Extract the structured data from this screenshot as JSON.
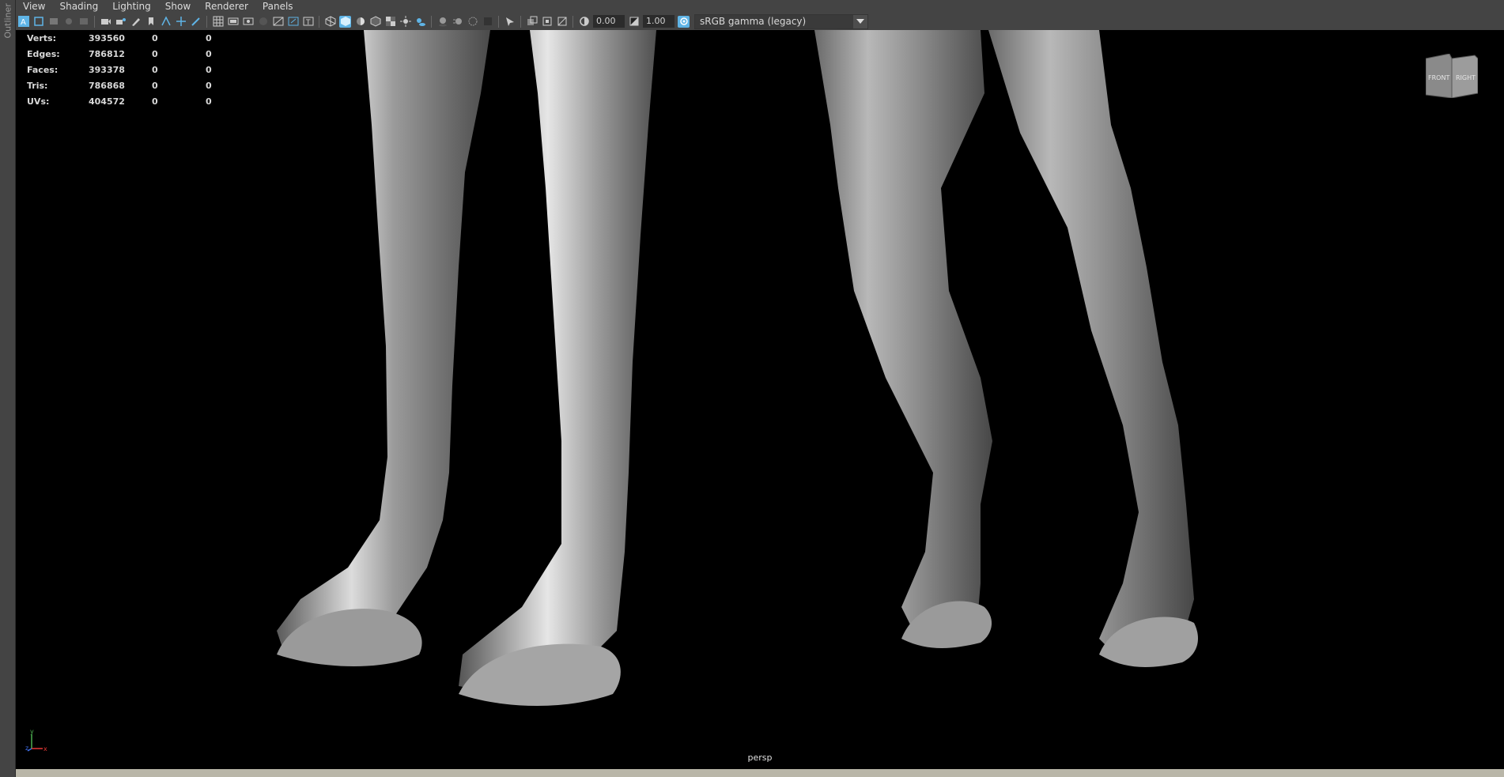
{
  "outliner": {
    "label": "Outliner"
  },
  "menubar": {
    "items": [
      "View",
      "Shading",
      "Lighting",
      "Show",
      "Renderer",
      "Panels"
    ]
  },
  "toolbar": {
    "exposure": "0.00",
    "gamma": "1.00",
    "colorspace": "sRGB gamma (legacy)",
    "accent": "#5fb4e6"
  },
  "hud": {
    "rows": [
      {
        "label": "Verts:",
        "value": "393560",
        "a": "0",
        "b": "0"
      },
      {
        "label": "Edges:",
        "value": "786812",
        "a": "0",
        "b": "0"
      },
      {
        "label": "Faces:",
        "value": "393378",
        "a": "0",
        "b": "0"
      },
      {
        "label": "Tris:",
        "value": "786868",
        "a": "0",
        "b": "0"
      },
      {
        "label": "UVs:",
        "value": "404572",
        "a": "0",
        "b": "0"
      }
    ]
  },
  "viewcube": {
    "front": "FRONT",
    "right": "RIGHT"
  },
  "axis": {
    "y": "y",
    "x": "x",
    "z": "z"
  },
  "camera": {
    "label": "persp"
  }
}
